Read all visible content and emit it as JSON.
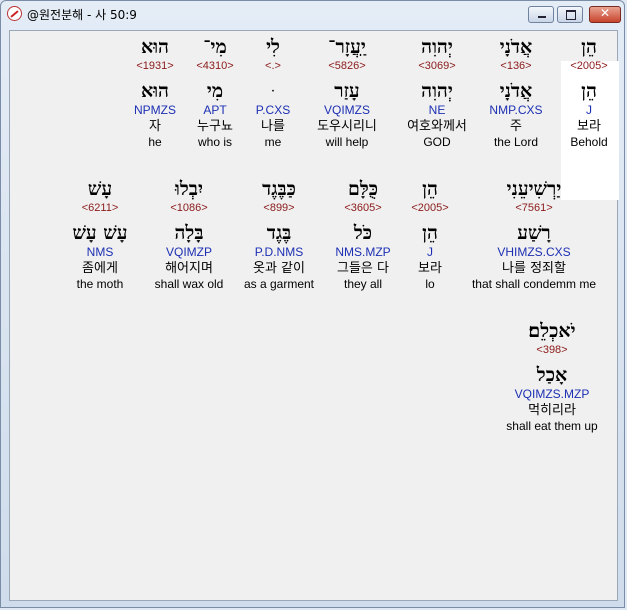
{
  "window": {
    "title": "@원전분해 - 사 50:9"
  },
  "rows": [
    [
      {
        "heb": "הֵן",
        "num": "<2005>",
        "heb2": "הֵן",
        "parse": "J",
        "kor": "보라",
        "eng": "Behold",
        "selected": true
      },
      {
        "heb": "אֲדֹנָי",
        "num": "<136>",
        "heb2": "אֲדֹנָי",
        "parse": "NMP.CXS",
        "kor": "주",
        "eng": "the Lord"
      },
      {
        "heb": "יְהוִה",
        "num": "<3069>",
        "heb2": "יְהוִה",
        "parse": "NE",
        "kor": "여호와께서",
        "eng": "GOD"
      },
      {
        "heb": "יַֽעֲזָר־",
        "num": "<5826>",
        "heb2": "עָזַר",
        "parse": "VQIMZS",
        "kor": "도우시리니",
        "eng": "will help"
      },
      {
        "heb": "לִי",
        "num": "<.>",
        "heb2": "ּ",
        "parse": "P.CXS",
        "kor": "나를",
        "eng": "me"
      },
      {
        "heb": "מִי־",
        "num": "<4310>",
        "heb2": "מִי",
        "parse": "APT",
        "kor": "누구뇨",
        "eng": "who is"
      },
      {
        "heb": "הוּא",
        "num": "<1931>",
        "heb2": "הוּא",
        "parse": "NPMZS",
        "kor": "자",
        "eng": "he"
      }
    ],
    [
      {
        "heb": "יַרְשִׁיעֵנִי",
        "num": "<7561>",
        "heb2": "רָשַׁע",
        "parse": "VHIMZS.CXS",
        "kor": "나를 정죄할",
        "eng": "that shall condemm me"
      },
      {
        "heb": "הֵן",
        "num": "<2005>",
        "heb2": "הֵן",
        "parse": "J",
        "kor": "보라",
        "eng": "lo"
      },
      {
        "heb": "כֻּלָּם",
        "num": "<3605>",
        "heb2": "כֹּל",
        "parse": "NMS.MZP",
        "kor": "그들은 다",
        "eng": "they all"
      },
      {
        "heb": "כַּבֶּגֶד",
        "num": "<899>",
        "heb2": "בֶּגֶד",
        "parse": "P.D.NMS",
        "kor": "옷과 같이",
        "eng": "as a garment"
      },
      {
        "heb": "יִבְלוּ",
        "num": "<1086>",
        "heb2": "בָּלָה",
        "parse": "VQIMZP",
        "kor": "해어지며",
        "eng": "shall wax old"
      },
      {
        "heb": "עָשׁ",
        "num": "<6211>",
        "heb2": "עָשׁ עָשׁ",
        "parse": "NMS",
        "kor": "좀에게",
        "eng": "the moth"
      }
    ],
    [
      {
        "heb": "יֹאכְלֵם׃",
        "num": "<398>",
        "heb2": "אָכַל",
        "parse": "VQIMZS.MZP",
        "kor": "먹히리라",
        "eng": "shall eat them up"
      }
    ]
  ]
}
